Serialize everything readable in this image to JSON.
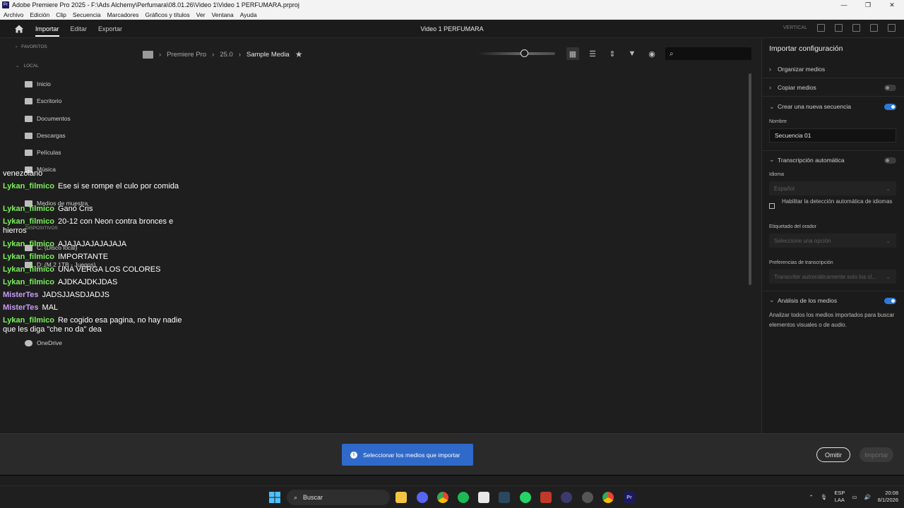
{
  "window": {
    "title": "Adobe Premiere Pro 2025 - F:\\Ads Alchemy\\Perfumara\\08.01.26\\Video 1\\Video 1 PERFUMARA.prproj",
    "app_icon": "Pr",
    "minimize": "—",
    "maximize": "❐",
    "close": "✕"
  },
  "menu": [
    "Archivo",
    "Edición",
    "Clip",
    "Secuencia",
    "Marcadores",
    "Gráficos y títulos",
    "Ver",
    "Ventana",
    "Ayuda"
  ],
  "header": {
    "tabs": [
      "Importar",
      "Editar",
      "Exportar"
    ],
    "project_title": "Video 1 PERFUMARA",
    "vertical_label": "VERTICAL"
  },
  "sidebar": {
    "favorites_label": "FAVORITOS",
    "local_label": "LOCAL",
    "local_items": [
      "Inicio",
      "Escritorio",
      "Documentos",
      "Descargas",
      "Películas",
      "Música",
      "Medios de muestra"
    ],
    "devices_label": "DISPOSITIVOS",
    "device_items": [
      "C: (Disco local)",
      "D: (M.2 1TB - Juegos)"
    ],
    "onedrive": "OneDrive"
  },
  "browser": {
    "breadcrumb": [
      "Premiere Pro",
      "25.0",
      "Sample Media"
    ],
    "zoom_level": 0.6
  },
  "settings": {
    "title": "Importar configuración",
    "organize": "Organizar medios",
    "copy": "Copiar medios",
    "new_sequence": "Crear una nueva secuencia",
    "name_label": "Nombre",
    "name_value": "Secuencia 01",
    "transcription": "Transcripción automática",
    "language_label": "Idioma",
    "language_value": "Español",
    "auto_detect": "Habilitar la detección automática de idiomas",
    "speaker_label": "Etiquetado del orador",
    "speaker_value": "Seleccione una opción",
    "prefs_label": "Preferencias de transcripción",
    "prefs_value": "Transcribir automáticamente solo los cl...",
    "analysis": "Análisis de los medios",
    "analysis_desc": "Analizar todos los medios importados para buscar elementos visuales o de audio.",
    "toggles": {
      "copy": false,
      "new_sequence": true,
      "transcription": false,
      "analysis": true
    }
  },
  "footer": {
    "toast": "Seleccionar los medios que importar",
    "omit": "Omitir",
    "import": "Importar"
  },
  "chat": [
    {
      "user": "",
      "text": "venezolano",
      "color": "#ffffff"
    },
    {
      "user": "Lykan_filmico",
      "text": "Ese si se rompe el culo por comida",
      "color": "#7cf05a"
    },
    {
      "user": "Lykan_filmico",
      "text": "Ganó Cris",
      "color": "#7cf05a"
    },
    {
      "user": "Lykan_filmico",
      "text": "20-12 con Neon contra bronces e hierros",
      "color": "#7cf05a"
    },
    {
      "user": "Lykan_filmico",
      "text": "AJAJAJAJAJAJAJA",
      "color": "#7cf05a"
    },
    {
      "user": "Lykan_filmico",
      "text": "IMPORTANTE",
      "color": "#7cf05a"
    },
    {
      "user": "Lykan_filmico",
      "text": "UNA VERGA LOS COLORES",
      "color": "#7cf05a"
    },
    {
      "user": "Lykan_filmico",
      "text": "AJDKAJDKJDAS",
      "color": "#7cf05a"
    },
    {
      "user": "MisterTes",
      "text": "JADSJJASDJADJS",
      "color": "#c69cf5"
    },
    {
      "user": "MisterTes",
      "text": "MAL",
      "color": "#c69cf5"
    },
    {
      "user": "Lykan_filmico",
      "text": "Re cogido esa pagina, no hay nadie que les diga \"che no da\" dea",
      "color": "#7cf05a"
    }
  ],
  "taskbar": {
    "search_placeholder": "Buscar",
    "lang": "ESP",
    "region": "LAA",
    "time": "20:08",
    "date": "8/1/2026"
  }
}
